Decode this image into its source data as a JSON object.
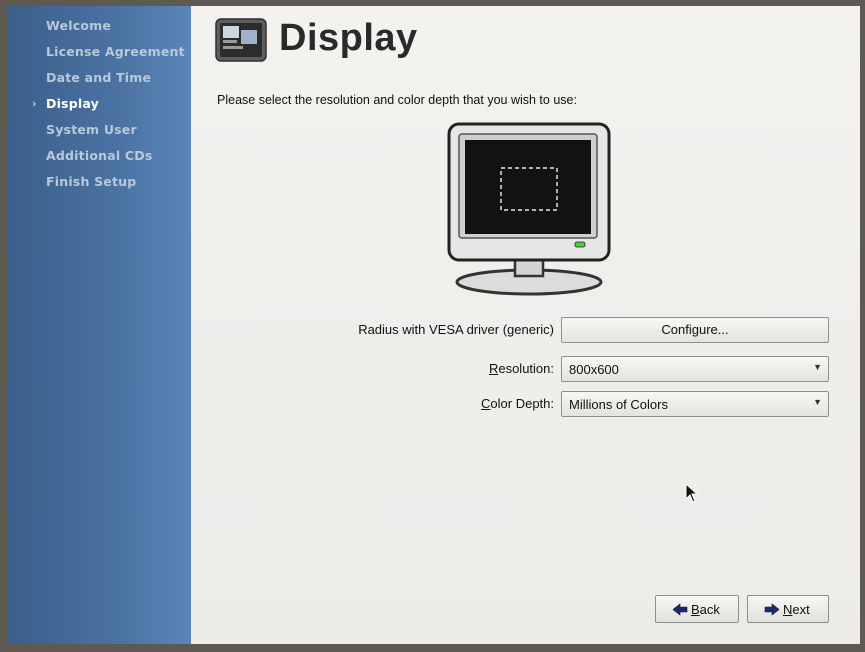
{
  "sidebar": {
    "items": [
      {
        "label": "Welcome"
      },
      {
        "label": "License Agreement"
      },
      {
        "label": "Date and Time"
      },
      {
        "label": "Display",
        "active": true
      },
      {
        "label": "System User"
      },
      {
        "label": "Additional CDs"
      },
      {
        "label": "Finish Setup"
      }
    ],
    "active_marker": "›"
  },
  "header": {
    "title": "Display",
    "icon": "display-icon"
  },
  "main": {
    "instruction": "Please select the resolution and color depth that you wish to use:",
    "monitor_image": "monitor-icon",
    "driver_label": "Radius with VESA driver (generic)",
    "configure_label": "Configure...",
    "resolution": {
      "label_mnemonic": "R",
      "label_rest": "esolution:",
      "value": "800x600"
    },
    "color_depth": {
      "label_mnemonic": "C",
      "label_rest": "olor Depth:",
      "value": "Millions of Colors"
    }
  },
  "footer": {
    "back": {
      "mnemonic": "B",
      "rest": "ack",
      "icon": "back-arrow-icon"
    },
    "next": {
      "mnemonic": "N",
      "rest": "ext",
      "icon": "next-arrow-icon"
    }
  },
  "colors": {
    "sidebar": "#4a72a3",
    "sidebar_text": "#b9c8db",
    "sidebar_active_text": "#ffffff",
    "background": "#eeedea",
    "arrow_accent": "#1d2a6b"
  }
}
